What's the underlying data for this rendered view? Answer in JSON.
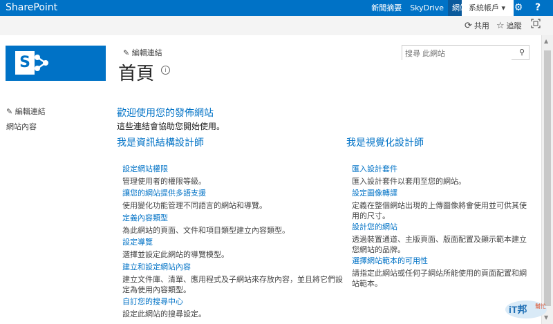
{
  "suitebar": {
    "brand": "SharePoint",
    "links": [
      "新聞摘要",
      "SkyDrive",
      "網站"
    ],
    "active_link": "網站",
    "user": "系統帳戶 ▾",
    "settings_icon": "gear-icon",
    "help_label": "?"
  },
  "commandbar": {
    "share": "共用",
    "follow": "追蹤"
  },
  "site": {
    "edit_link": "編輯連結",
    "title": "首頁",
    "search_placeholder": "搜尋 此網站"
  },
  "leftnav": {
    "edit_link": "編輯連結",
    "items": [
      "網站內容"
    ]
  },
  "welcome": {
    "title": "歡迎使用您的發佈網站",
    "subtitle": "這些連結會協助您開始使用。"
  },
  "columns": [
    {
      "heading": "我是資訊結構設計師",
      "items": [
        {
          "title": "設定網站權限",
          "desc": "管理使用者的權限等級。"
        },
        {
          "title": "讓您的網站提供多語支援",
          "desc": "使用變化功能管理不同語言的網站和導覽。"
        },
        {
          "title": "定義內容類型",
          "desc": "為此網站的頁面、文件和項目類型建立內容類型。"
        },
        {
          "title": "設定導覽",
          "desc": "選擇並設定此網站的導覽模型。"
        },
        {
          "title": "建立和設定網站內容",
          "desc": "建立文件庫、清單、應用程式及子網站來存放內容，並且將它們設定為使用內容類型。"
        },
        {
          "title": "自訂您的搜尋中心",
          "desc": "設定此網站的搜尋設定。"
        }
      ]
    },
    {
      "heading": "我是視覺化設計師",
      "items": [
        {
          "title": "匯入設計套件",
          "desc": "匯入設計套件以套用至您的網站。"
        },
        {
          "title": "設定圖像轉譯",
          "desc": "定義在整個網站出現的上傳圖像將會使用並可供其使用的尺寸。"
        },
        {
          "title": "設計您的網站",
          "desc": "透過裝置通道、主版頁面、版面配置及顯示範本建立您網站的品牌。"
        },
        {
          "title": "選擇網站範本的可用性",
          "desc": "請指定此網站或任何子網站所能使用的頁面配置和網站範本。"
        }
      ]
    }
  ],
  "watermark": {
    "text": "iT邦",
    "sub": "幫忙"
  },
  "colors": {
    "brand_blue": "#0072c6",
    "text": "#444444"
  }
}
